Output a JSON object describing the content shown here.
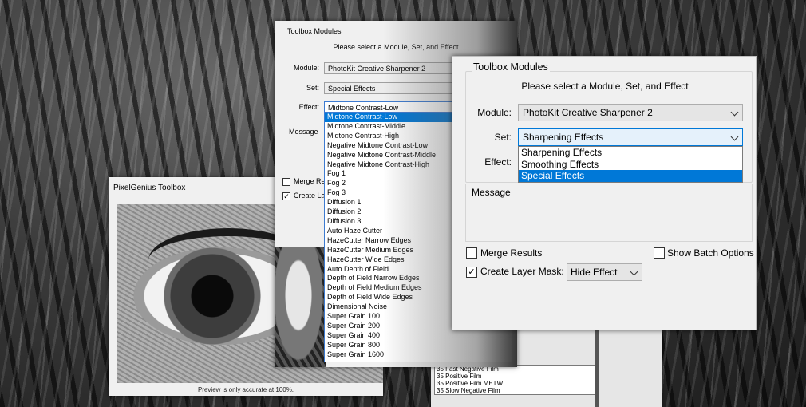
{
  "back_dialog": {
    "title": "PixelGenius Toolbox",
    "preview_note": "Preview is only accurate at 100%."
  },
  "film_list": {
    "items": [
      "35 Fast Negative Film",
      "35 Positive Film",
      "35 Positive Film METW",
      "35 Slow Negative Film"
    ]
  },
  "mid_dialog": {
    "group_title": "Toolbox Modules",
    "prompt": "Please select a Module, Set, and Effect",
    "module_label": "Module:",
    "module_value": "PhotoKit Creative Sharpener 2",
    "set_label": "Set:",
    "set_value": "Special Effects",
    "effect_label": "Effect:",
    "effect_value": "Midtone Contrast-Low",
    "message_label": "Message",
    "merge_label": "Merge Re",
    "create_label": "Create La",
    "effect_options": [
      "Midtone Contrast-Low",
      "Midtone Contrast-Middle",
      "Midtone Contrast-High",
      "Negative Midtone Contrast-Low",
      "Negative Midtone Contrast-Middle",
      "Negative Midtone Contrast-High",
      "Fog 1",
      "Fog 2",
      "Fog 3",
      "Diffusion 1",
      "Diffusion 2",
      "Diffusion 3",
      "Auto Haze Cutter",
      "HazeCutter Narrow Edges",
      "HazeCutter Medium Edges",
      "HazeCutter Wide Edges",
      "Auto Depth of Field",
      "Depth of Field Narrow Edges",
      "Depth of Field Medium Edges",
      "Depth of Field Wide Edges",
      "Dimensional Noise",
      "Super Grain 100",
      "Super Grain 200",
      "Super Grain 400",
      "Super Grain 800",
      "Super Grain 1600"
    ],
    "selected_effect_index": 0
  },
  "front_dialog": {
    "group_title": "Toolbox Modules",
    "prompt": "Please select a Module, Set, and Effect",
    "module_label": "Module:",
    "module_value": "PhotoKit Creative Sharpener 2",
    "set_label": "Set:",
    "set_value": "Sharpening Effects",
    "effect_label": "Effect:",
    "set_options": [
      "Sharpening Effects",
      "Smoothing Effects",
      "Special Effects"
    ],
    "selected_set_index": 2,
    "message_label": "Message",
    "merge_label": "Merge Results",
    "merge_checked": false,
    "batch_label": "Show Batch Options",
    "batch_checked": false,
    "mask_label": "Create Layer Mask:",
    "mask_checked": true,
    "mask_value": "Hide Effect"
  },
  "check_glyph": "✓",
  "colors": {
    "selection": "#0078d7",
    "dialog_bg": "#f0f0f0",
    "focus_border": "#0078d7"
  }
}
